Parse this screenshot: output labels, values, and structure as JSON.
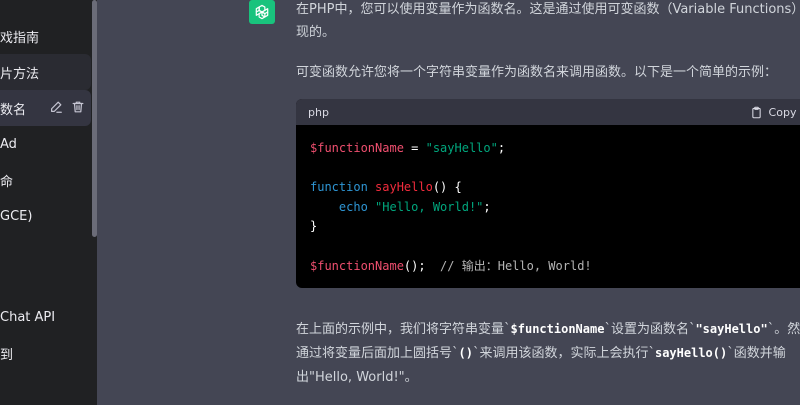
{
  "sidebar": {
    "items": [
      {
        "label": "戏指南"
      },
      {
        "label": "片方法"
      },
      {
        "label": "数名"
      },
      {
        "label": "Ad"
      },
      {
        "label": "命"
      },
      {
        "label": "GCE)"
      },
      {
        "label": "Chat API"
      },
      {
        "label": "到"
      }
    ],
    "edit_icon": "pencil-icon",
    "delete_icon": "trash-icon"
  },
  "message": {
    "avatar_icon": "openai-logo-icon",
    "intro_line1": "在PHP中，您可以使用变量作为函数名。这是通过使用可变函数（Variable Functions）来",
    "intro_line2": "现的。",
    "para2": "可变函数允许您将一个字符串变量作为函数名来调用函数。以下是一个简单的示例：",
    "code": {
      "language": "php",
      "copy_label": "Copy c",
      "line1_var": "$functionName",
      "line1_eq": " = ",
      "line1_str": "\"sayHello\"",
      "line1_end": ";",
      "line3_kw": "function",
      "line3_fn": "sayHello",
      "line3_end": "() {",
      "line4_indent": "    ",
      "line4_kw": "echo",
      "line4_str": " \"Hello, World!\"",
      "line4_end": ";",
      "line5": "}",
      "line7_var": "$functionName",
      "line7_end": "();",
      "line7_comment": "  // 输出：Hello, World!"
    },
    "p3": {
      "t1": "在上面的示例中，我们将字符串变量`",
      "c1": "$functionName",
      "t2": "`设置为函数名`",
      "c2": "\"sayHello\"",
      "t3": "`。然后",
      "t4": "通过将变量后面加上圆括号`",
      "c3": "()",
      "t5": "`来调用该函数，实际上会执行`",
      "c4": "sayHello()",
      "t6": "`函数并输",
      "t7": "出\"Hello, World!\"。"
    }
  }
}
